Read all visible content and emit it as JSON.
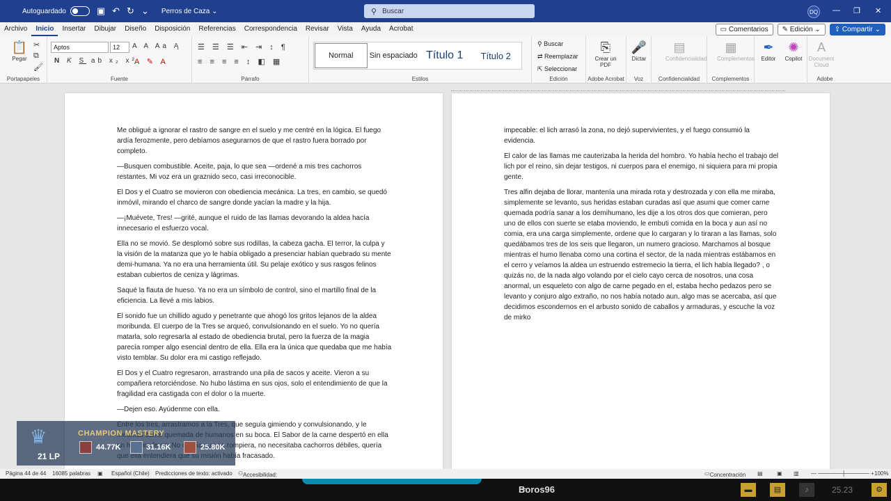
{
  "titlebar": {
    "autosave_label": "Autoguardado",
    "doc_name": "Perros de Caza",
    "search_placeholder": "Buscar",
    "user_initials": "DQ"
  },
  "menu": {
    "tabs": [
      "Archivo",
      "Inicio",
      "Insertar",
      "Dibujar",
      "Diseño",
      "Disposición",
      "Referencias",
      "Correspondencia",
      "Revisar",
      "Vista",
      "Ayuda",
      "Acrobat"
    ],
    "comments": "Comentarios",
    "editing": "Edición",
    "share": "Compartir"
  },
  "ribbon": {
    "paste": "Pegar",
    "font_name": "Aptos",
    "font_size": "12",
    "styles": [
      "Normal",
      "Sin espaciado",
      "Título 1",
      "Título 2"
    ],
    "find": "Buscar",
    "replace": "Reemplazar",
    "select": "Seleccionar",
    "create_pdf": "Crear un PDF",
    "dictate": "Dictar",
    "confidentiality": "Confidencialidad",
    "add_ins": "Complementos",
    "editor": "Editor",
    "copilot": "Copilot",
    "document_cloud": "Document Cloud",
    "groups": {
      "clipboard": "Portapapeles",
      "font": "Fuente",
      "paragraph": "Párrafo",
      "styles": "Estilos",
      "editing": "Edición",
      "acrobat": "Adobe Acrobat",
      "voice": "Voz",
      "confidentiality": "Confidencialidad",
      "addins": "Complementos",
      "adobe": "Adobe"
    }
  },
  "left_page": [
    "Me obligué a ignorar el rastro de sangre en el suelo y me centré en la lógica. El fuego ardía ferozmente, pero debíamos asegurarnos de que el rastro fuera borrado por completo.",
    "—Busquen combustible. Aceite, paja, lo que sea —ordené a mis tres cachorros restantes. Mi voz era un graznido seco, casi irreconocible.",
    "El Dos y el Cuatro se movieron con obediencia mecánica. La tres, en cambio, se quedó inmóvil, mirando el charco de sangre donde yacían la madre y la hija.",
    "—¡Muévete, Tres! —grité, aunque el ruido de las llamas devorando la aldea hacía innecesario el esfuerzo vocal.",
    "Ella no se movió. Se desplomó sobre sus rodillas, la cabeza gacha. El terror, la culpa y la visión de la matanza que yo le había obligado a presenciar habían quebrado su mente demi-humana. Ya no era una herramienta útil. Su pelaje exótico y sus rasgos felinos estaban cubiertos de ceniza y lágrimas.",
    "Saqué la flauta de hueso. Ya no era un símbolo de control, sino el martillo final de la eficiencia. La llevé a mis labios.",
    "El sonido fue un chillido agudo y penetrante que ahogó los gritos lejanos de la aldea moribunda. El cuerpo de la Tres se arqueó, convulsionando en el suelo. Yo no quería matarla, solo regresarla al estado de obediencia brutal, pero la fuerza de la magia parecía romper algo esencial dentro de ella. Ella era la única que quedaba que me había visto temblar. Su dolor era mi castigo reflejado.",
    "El Dos y el Cuatro regresaron, arrastrando una pila de sacos y aceite. Vieron a su compañera retorciéndose. No hubo lástima en sus ojos, solo el entendimiento de que la fragilidad era castigada con el dolor o la muerte.",
    "—Dejen eso. Ayúdenme con ella.",
    "Entre los tres, arrastramos a la Tres, que seguía gimiendo y convulsionando, y le metimos carne quemada de humanos en su boca. El Sabor de la carne despertó en ella un hambre feroz. No quería que se rompiera, no necesitaba cachorros débiles, quería que ella entendiera que su misión había fracasado."
  ],
  "right_page": [
    "impecable: el lich arrasó la zona, no dejó supervivientes, y el fuego consumió la evidencia.",
    "El calor de las llamas me cauterizaba la herida del hombro. Yo había hecho el trabajo del lich por el reino, sin dejar testigos, ni cuerpos para el enemigo, ni siquiera para mi propia gente.",
    "Tres alfin dejaba de llorar, mantenía una mirada rota y destrozada y con ella me miraba, simplemente se levanto, sus heridas estaban curadas así que asumi que comer carne quemada podría sanar a los demihumano, les dije a los otros dos que comieran, pero uno de ellos con suerte se etaba moviendo, le embuti comida en la boca y aun así no comia, era una carga simplemente, ordene que lo cargaran y lo tiraran a las llamas, solo quedábamos tres de los seis que llegaron, un numero gracioso. Marchamos al bosque mientras el humo llenaba como una cortina el sector, de la nada mientras estábamos en el cerro y veíamos la aldea un estruendo estremecio la tierra, el lich había llegado? , o quizás no, de la nada algo volando por el cielo cayo cerca de nosotros, una cosa anormal, un esqueleto con algo de carne pegado en el, estaba hecho pedazos pero se levanto y conjuro algo extraño, no nos había notado aun, algo mas se acercaba, así que decidimos escondernos en el arbusto sonido de caballos y armaduras, y escuche la voz de mirko"
  ],
  "overlay": {
    "title": "CHAMPION MASTERY",
    "lp": "21 LP",
    "stats": [
      "44.77K",
      "31.16K",
      "25.80K"
    ]
  },
  "status": {
    "page": "Página 44 de 44",
    "words": "16085 palabras",
    "language": "Español (Chile)",
    "predictions": "Predicciones de texto: activado",
    "accessibility": "Accesibilidad: todo correcto",
    "focus": "Concentración",
    "zoom": "100%"
  },
  "taskbar": {
    "player": "Boros96",
    "timer": "25.23"
  }
}
